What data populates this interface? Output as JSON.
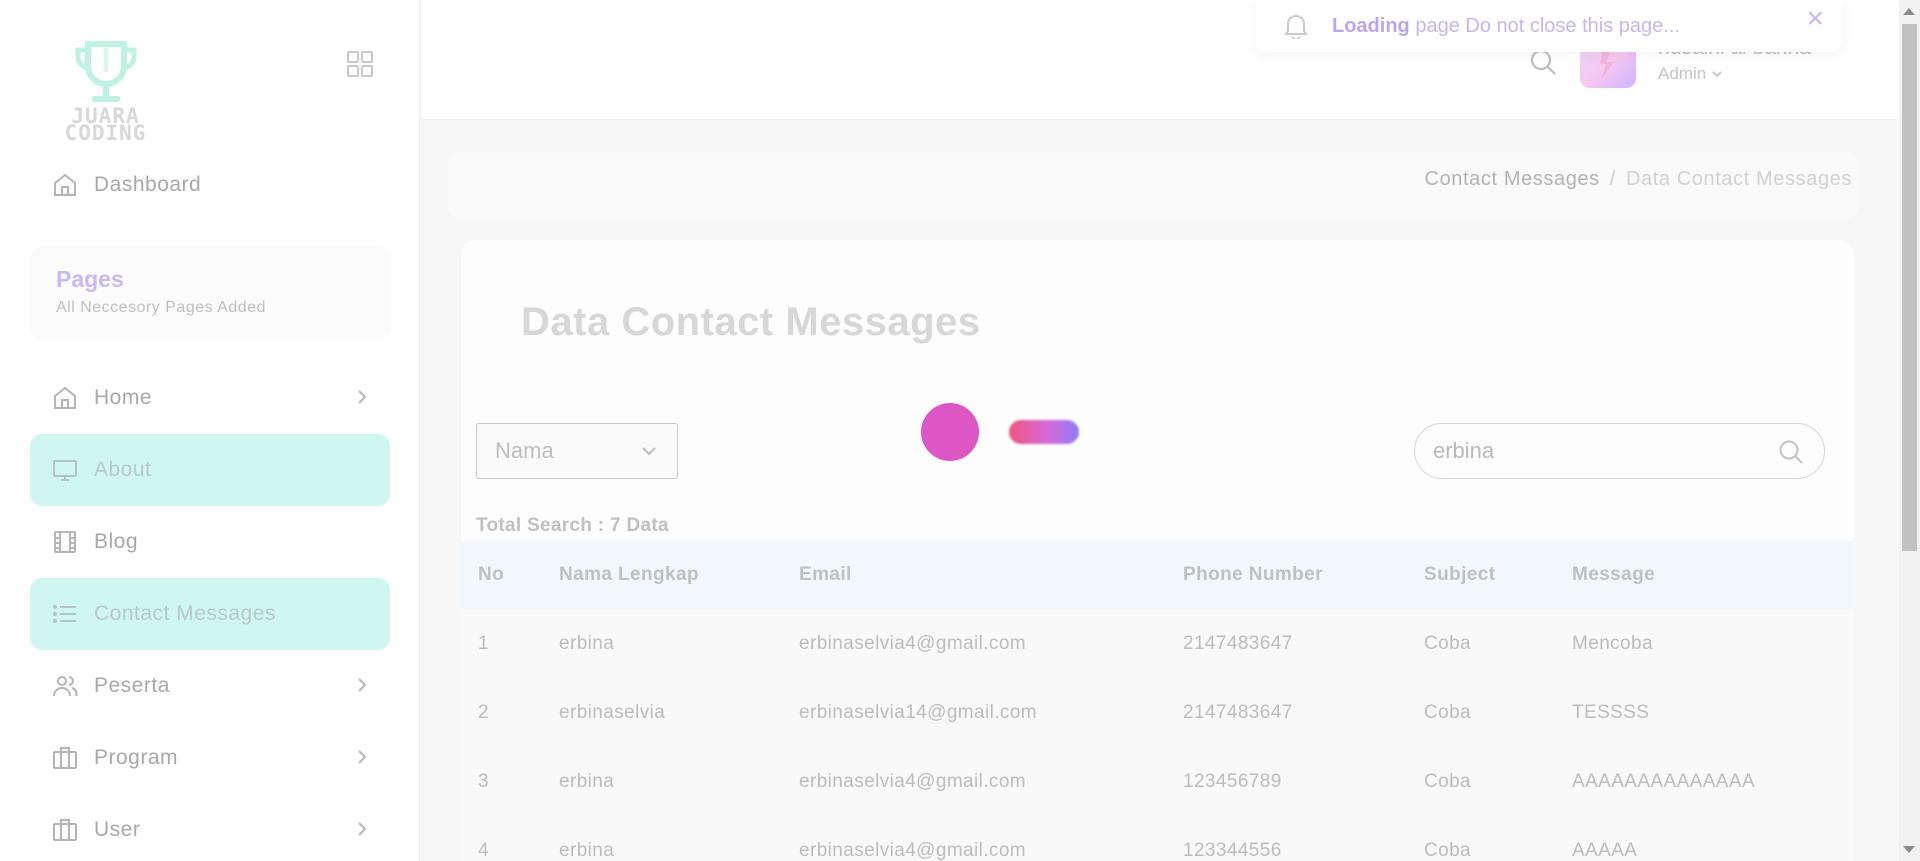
{
  "logo": {
    "text_line1": "JUARA",
    "text_line2": "CODING"
  },
  "sidebar": {
    "dashboard_label": "Dashboard",
    "pages_title": "Pages",
    "pages_subtitle": "All Neccesory Pages Added",
    "items": [
      {
        "label": "Home",
        "icon": "home-icon",
        "has_arrow": true,
        "active": false
      },
      {
        "label": "About",
        "icon": "monitor-icon",
        "has_arrow": false,
        "active": true
      },
      {
        "label": "Blog",
        "icon": "film-icon",
        "has_arrow": false,
        "active": false
      },
      {
        "label": "Contact Messages",
        "icon": "list-icon",
        "has_arrow": false,
        "active": true
      },
      {
        "label": "Peserta",
        "icon": "users-icon",
        "has_arrow": true,
        "active": false
      },
      {
        "label": "Program",
        "icon": "briefcase-icon",
        "has_arrow": true,
        "active": false
      },
      {
        "label": "User",
        "icon": "briefcase-icon",
        "has_arrow": true,
        "active": false
      }
    ]
  },
  "topbar": {
    "user_name": "husaini al banna",
    "user_role": "Admin"
  },
  "notification": {
    "bold": "Loading",
    "text": " page Do not close this page...",
    "close": "×"
  },
  "breadcrumb": {
    "parent": "Contact Messages",
    "separator": "/",
    "current": "Data Contact Messages"
  },
  "main": {
    "title": "Data Contact Messages",
    "filter_select": {
      "value": "Nama"
    },
    "search": {
      "value": "erbina"
    },
    "total_label": "Total Search : 7 Data"
  },
  "table": {
    "headers": [
      "No",
      "Nama Lengkap",
      "Email",
      "Phone Number",
      "Subject",
      "Message"
    ],
    "rows": [
      [
        "1",
        "erbina",
        "erbinaselvia4@gmail.com",
        "2147483647",
        "Coba",
        "Mencoba"
      ],
      [
        "2",
        "erbinaselvia",
        "erbinaselvia14@gmail.com",
        "2147483647",
        "Coba",
        "TESSSS"
      ],
      [
        "3",
        "erbina",
        "erbinaselvia4@gmail.com",
        "123456789",
        "Coba",
        "AAAAAAAAAAAAAA"
      ],
      [
        "4",
        "erbina",
        "erbinaselvia4@gmail.com",
        "123344556",
        "Coba",
        "AAAAA"
      ]
    ]
  },
  "colors": {
    "active_menu_bg": "#cff7ef",
    "loader_ball": "#dc56c6",
    "notification_accent": "#b8a6ee",
    "table_header_bg": "#f2f7fc"
  }
}
